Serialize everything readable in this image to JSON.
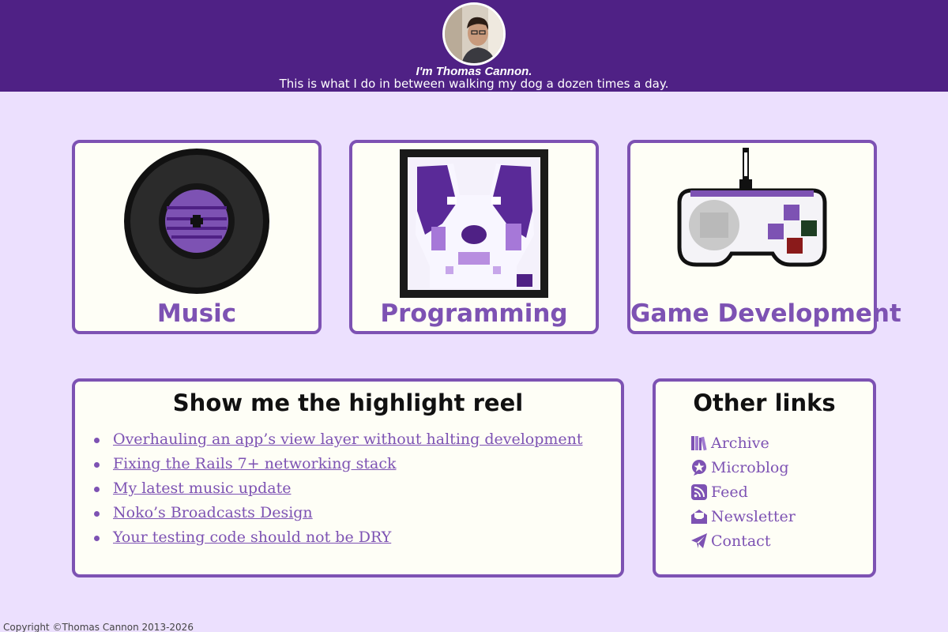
{
  "header": {
    "name": "I'm Thomas Cannon.",
    "tagline": "This is what I do in between walking my dog a dozen times a day."
  },
  "cards": [
    {
      "label": "Music",
      "icon": "vinyl-record-icon"
    },
    {
      "label": "Programming",
      "icon": "dog-portrait-icon"
    },
    {
      "label": "Game Development",
      "icon": "game-controller-icon"
    }
  ],
  "highlights": {
    "title": "Show me the highlight reel",
    "items": [
      "Overhauling an app’s view layer without halting development",
      "Fixing the Rails 7+ networking stack",
      "My latest music update",
      "Noko’s Broadcasts Design",
      "Your testing code should not be DRY"
    ]
  },
  "other_links": {
    "title": "Other links",
    "items": [
      {
        "label": "Archive",
        "icon": "books-icon"
      },
      {
        "label": "Microblog",
        "icon": "star-badge-icon"
      },
      {
        "label": "Feed",
        "icon": "rss-icon"
      },
      {
        "label": "Newsletter",
        "icon": "envelope-open-icon"
      },
      {
        "label": "Contact",
        "icon": "paper-plane-icon"
      }
    ]
  },
  "footer": {
    "copyright": "Copyright ©Thomas Cannon 2013-2026"
  },
  "colors": {
    "header_bg": "#4f2185",
    "accent": "#7d52b3",
    "page_bg": "#ece0fe",
    "card_bg": "#fefef6"
  }
}
